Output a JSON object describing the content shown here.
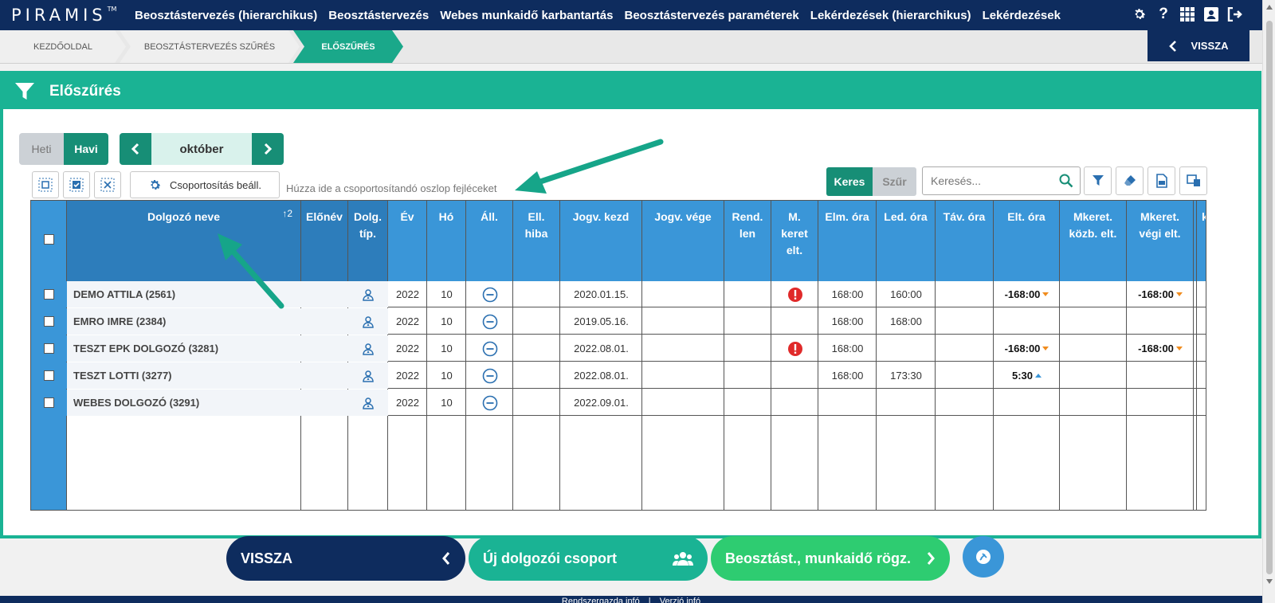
{
  "app": {
    "logo": "PIRAMIS",
    "trademark": "TM",
    "menu": [
      "Beosztástervezés (hierarchikus)",
      "Beosztástervezés",
      "Webes munkaidő karbantartás",
      "Beosztástervezés paraméterek",
      "Lekérdezések (hierarchikus)",
      "Lekérdezések"
    ],
    "icons": [
      "gear-icon",
      "help-icon",
      "grid-apps-icon",
      "user-card-icon",
      "logout-icon"
    ]
  },
  "breadcrumb": [
    "KEZDŐOLDAL",
    "BEOSZTÁSTERVEZÉS SZŰRÉS",
    "ELŐSZŰRÉS"
  ],
  "back_top": "VISSZA",
  "panel": {
    "title": "Előszűrés"
  },
  "view_toggle": {
    "heti": "Heti",
    "havi": "Havi",
    "selected": "Havi"
  },
  "month": "október",
  "toolbar": {
    "group_button": "Csoportosítás beáll.",
    "drop_hint": "Húzza ide a csoportosítandó oszlop fejléceket",
    "keres": "Keres",
    "szur": "Szűr",
    "search_placeholder": "Keresés..."
  },
  "grid": {
    "sort_indicator": "↑2",
    "columns": [
      "Dolgozó neve",
      "Előnév",
      "Dolg. típ.",
      "Év",
      "Hó",
      "Áll.",
      "Ell. hiba",
      "Jogv. kezd",
      "Jogv. vége",
      "Rend. len",
      "M. keret elt.",
      "Elm. óra",
      "Led. óra",
      "Táv. óra",
      "Elt. óra",
      "Mkeret. közb. elt.",
      "Mkeret. végi elt.",
      "k"
    ],
    "rows": [
      {
        "name": "DEMO ATTILA (2561)",
        "ev": "2022",
        "ho": "10",
        "jogv_kezd": "2020.01.15.",
        "mkeret_err": true,
        "elm": "168:00",
        "led": "160:00",
        "elt": "-168:00",
        "elt_dir": "down",
        "mveg": "-168:00",
        "mveg_dir": "down"
      },
      {
        "name": "EMRO IMRE (2384)",
        "ev": "2022",
        "ho": "10",
        "jogv_kezd": "2019.05.16.",
        "mkeret_err": false,
        "elm": "168:00",
        "led": "168:00",
        "elt": "",
        "elt_dir": "",
        "mveg": "",
        "mveg_dir": ""
      },
      {
        "name": "TESZT EPK DOLGOZÓ (3281)",
        "ev": "2022",
        "ho": "10",
        "jogv_kezd": "2022.08.01.",
        "mkeret_err": true,
        "elm": "168:00",
        "led": "",
        "elt": "-168:00",
        "elt_dir": "down",
        "mveg": "-168:00",
        "mveg_dir": "down"
      },
      {
        "name": "TESZT LOTTI (3277)",
        "ev": "2022",
        "ho": "10",
        "jogv_kezd": "2022.08.01.",
        "mkeret_err": false,
        "elm": "168:00",
        "led": "173:30",
        "elt": "5:30",
        "elt_dir": "up",
        "mveg": "",
        "mveg_dir": ""
      },
      {
        "name": "WEBES DOLGOZÓ (3291)",
        "ev": "2022",
        "ho": "10",
        "jogv_kezd": "2022.09.01.",
        "mkeret_err": false,
        "elm": "",
        "led": "",
        "elt": "",
        "elt_dir": "",
        "mveg": "",
        "mveg_dir": ""
      }
    ]
  },
  "bottom": {
    "back": "VISSZA",
    "new_group": "Új dolgozói csoport",
    "record": "Beosztást., munkaidő rögz."
  },
  "footer": {
    "left": "Rendszergazda infó",
    "sep": "|",
    "right": "Verzió infó"
  },
  "colors": {
    "navy": "#0e2c5e",
    "teal": "#1ab394",
    "blue": "#3a96d8",
    "green": "#2ecc71",
    "error": "#e02a2a",
    "orange": "#f08c1e"
  }
}
